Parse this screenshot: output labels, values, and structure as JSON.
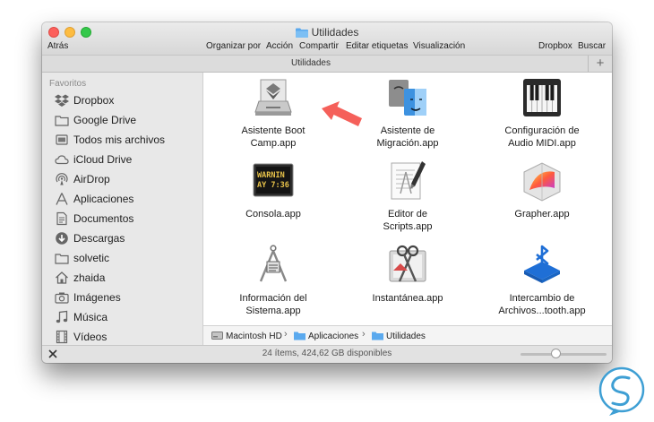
{
  "window": {
    "title": "Utilidades",
    "path_header": "Utilidades",
    "plus_label": "+"
  },
  "toolbar": {
    "back": "Atrás",
    "organize": "Organizar por",
    "action": "Acción",
    "share": "Compartir",
    "edit_tags": "Editar etiquetas",
    "view": "Visualización",
    "dropbox": "Dropbox",
    "search": "Buscar"
  },
  "sidebar": {
    "section": "Favoritos",
    "items": [
      {
        "label": "Dropbox",
        "icon": "dropbox-icon"
      },
      {
        "label": "Google Drive",
        "icon": "folder-icon"
      },
      {
        "label": "Todos mis archivos",
        "icon": "all-files-icon"
      },
      {
        "label": "iCloud Drive",
        "icon": "cloud-icon"
      },
      {
        "label": "AirDrop",
        "icon": "airdrop-icon"
      },
      {
        "label": "Aplicaciones",
        "icon": "applications-icon"
      },
      {
        "label": "Documentos",
        "icon": "documents-icon"
      },
      {
        "label": "Descargas",
        "icon": "downloads-icon"
      },
      {
        "label": "solvetic",
        "icon": "folder-icon"
      },
      {
        "label": "zhaida",
        "icon": "home-icon"
      },
      {
        "label": "Imágenes",
        "icon": "camera-icon"
      },
      {
        "label": "Música",
        "icon": "music-icon"
      },
      {
        "label": "Vídeos",
        "icon": "film-icon"
      }
    ]
  },
  "apps": [
    {
      "line1": "Asistente Boot",
      "line2": "Camp.app",
      "icon": "boot-camp-icon"
    },
    {
      "line1": "Asistente de",
      "line2": "Migración.app",
      "icon": "migration-icon"
    },
    {
      "line1": "Configuración de",
      "line2": "Audio MIDI.app",
      "icon": "piano-icon"
    },
    {
      "line1": "Consola.app",
      "line2": "",
      "icon": "console-icon",
      "screen_text_1": "WARNIN",
      "screen_text_2": "AY 7:36"
    },
    {
      "line1": "Editor de",
      "line2": "Scripts.app",
      "icon": "script-editor-icon"
    },
    {
      "line1": "Grapher.app",
      "line2": "",
      "icon": "grapher-icon"
    },
    {
      "line1": "Información del",
      "line2": "Sistema.app",
      "icon": "system-info-icon"
    },
    {
      "line1": "Instantánea.app",
      "line2": "",
      "icon": "screenshot-icon"
    },
    {
      "line1": "Intercambio de",
      "line2": "Archivos...tooth.app",
      "icon": "bluetooth-icon"
    }
  ],
  "pathbar": {
    "seg1": "Macintosh HD",
    "seg2": "Aplicaciones",
    "seg3": "Utilidades",
    "separator": "›"
  },
  "status": {
    "text": "24 ítems, 424,62 GB disponibles",
    "zoom_fraction": 0.4
  },
  "colors": {
    "arrow": "#f5605a",
    "folder": "#5aa9ee",
    "logo": "#3e9fd4"
  }
}
